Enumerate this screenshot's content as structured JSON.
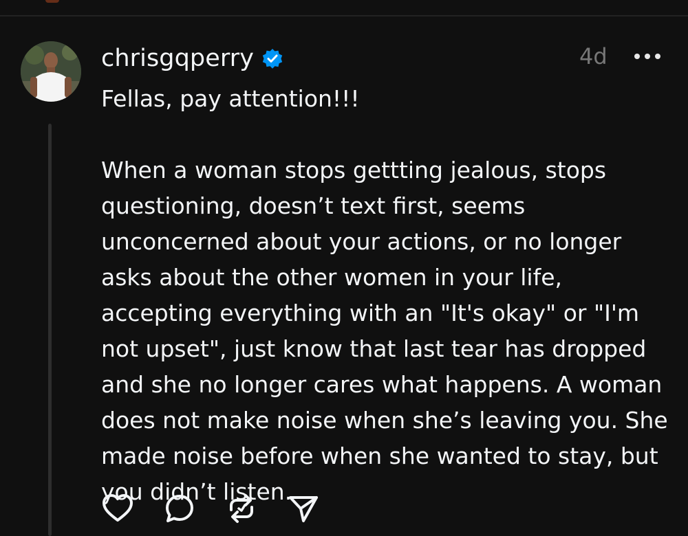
{
  "post": {
    "username": "chrisgqperry",
    "verified": true,
    "timestamp": "4d",
    "paragraphs": [
      "Fellas, pay attention!!!",
      "When a woman stops gettting jealous, stops questioning, doesn’t text first, seems unconcerned about your actions, or no longer asks about the other women in your life, accepting everything with an \"It's okay\" or \"I'm not upset\", just know that last tear has dropped and she no longer cares what happens. A woman does not make noise when she’s leaving you. She made noise before when she wanted to stay, but you didn’t listen."
    ]
  },
  "icons": {
    "verified": "verified-badge-icon",
    "more": "more-horizontal-icon",
    "like": "heart-icon",
    "comment": "comment-bubble-icon",
    "repost": "repost-icon",
    "share": "send-icon"
  },
  "colors": {
    "background": "#101010",
    "text": "#f3f5f7",
    "muted": "#777777",
    "verified": "#0095f6",
    "thread_line": "#2e2e2e"
  }
}
